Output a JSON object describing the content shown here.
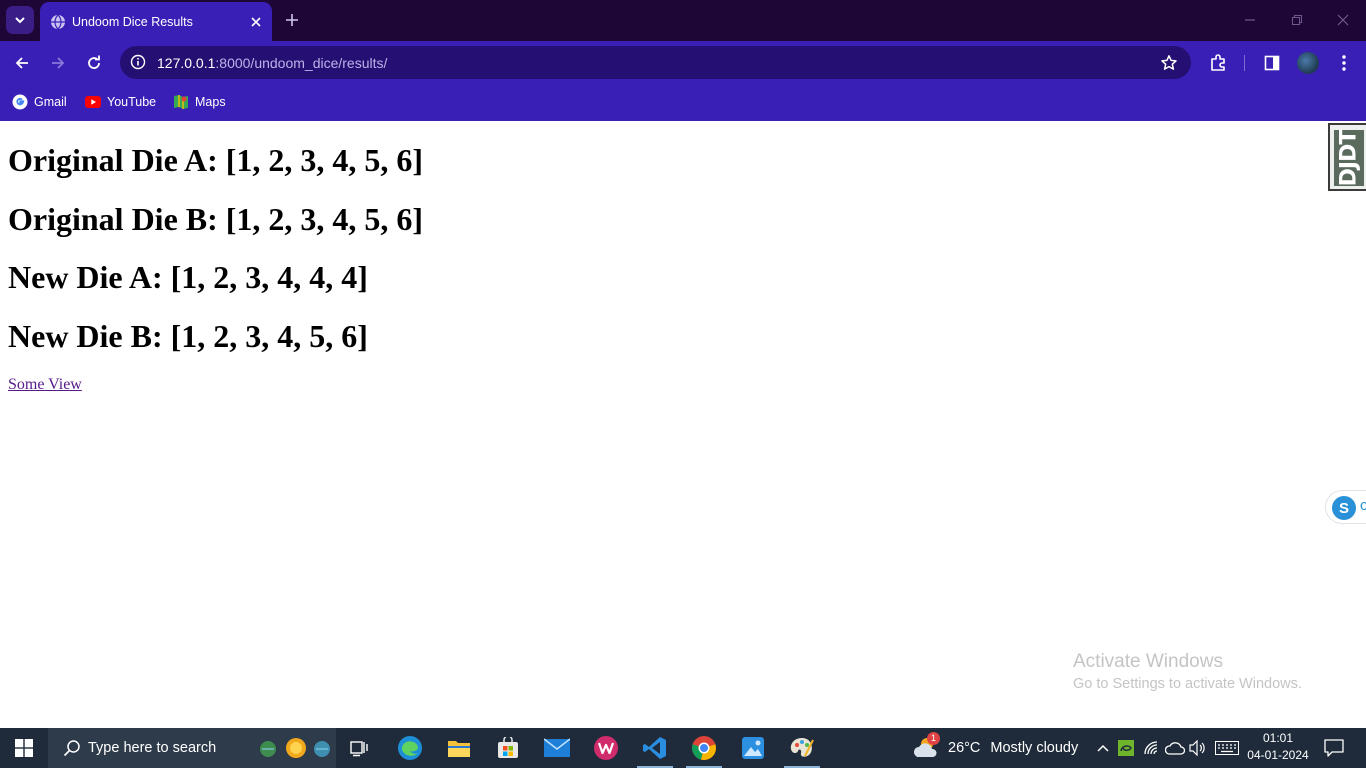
{
  "browser": {
    "tab": {
      "title": "Undoom Dice Results"
    },
    "url": {
      "host": "127.0.0.1",
      "path": ":8000/undoom_dice/results/"
    },
    "bookmarks": [
      {
        "label": "Gmail",
        "icon": "gmail-icon"
      },
      {
        "label": "YouTube",
        "icon": "youtube-icon"
      },
      {
        "label": "Maps",
        "icon": "maps-icon"
      }
    ],
    "colors": {
      "tabstrip": "#1e0636",
      "toolbar": "#3a1fb6",
      "omnibox": "#260f72"
    }
  },
  "page": {
    "headings": [
      "Original Die A: [1, 2, 3, 4, 5, 6]",
      "Original Die B: [1, 2, 3, 4, 5, 6]",
      "New Die A: [1, 2, 3, 4, 4, 4]",
      "New Die B: [1, 2, 3, 4, 5, 6]"
    ],
    "link_label": "Some View",
    "debug_toolbar_label": "DJDT",
    "skype_letter": "S",
    "skype_partial": "c"
  },
  "watermark": {
    "title": "Activate Windows",
    "subtitle": "Go to Settings to activate Windows."
  },
  "taskbar": {
    "search_placeholder": "Type here to search",
    "apps": [
      "task-view-icon",
      "edge-icon",
      "file-explorer-icon",
      "microsoft-store-icon",
      "mail-icon",
      "wps-office-icon",
      "vscode-icon",
      "chrome-icon",
      "photos-icon",
      "paint-icon"
    ],
    "weather": {
      "temp": "26°C",
      "condition": "Mostly cloudy",
      "badge": "1"
    },
    "clock": {
      "time": "01:01",
      "date": "04-01-2024"
    }
  }
}
